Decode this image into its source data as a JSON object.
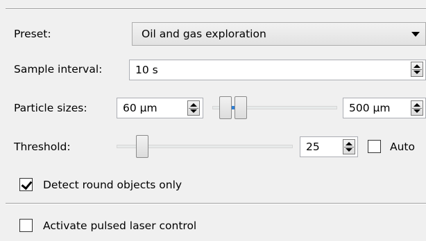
{
  "preset": {
    "label": "Preset:",
    "value": "Oil and gas exploration"
  },
  "sample_interval": {
    "label": "Sample interval:",
    "value": "10 s"
  },
  "particle_sizes": {
    "label": "Particle sizes:",
    "min_value": "60 µm",
    "max_value": "500 µm",
    "range_slider": {
      "low_fraction": 0.06,
      "high_fraction": 0.2
    }
  },
  "threshold": {
    "label": "Threshold:",
    "value": "25",
    "auto_label": "Auto",
    "auto_checked": false,
    "slider": {
      "fraction": 0.12
    }
  },
  "detect_round": {
    "label": "Detect round objects only",
    "checked": true
  },
  "pulsed_laser": {
    "label": "Activate pulsed laser control",
    "checked": false
  },
  "colors": {
    "accent": "#2f7fd3",
    "background": "#f0f0f0",
    "border": "#abadb3"
  }
}
